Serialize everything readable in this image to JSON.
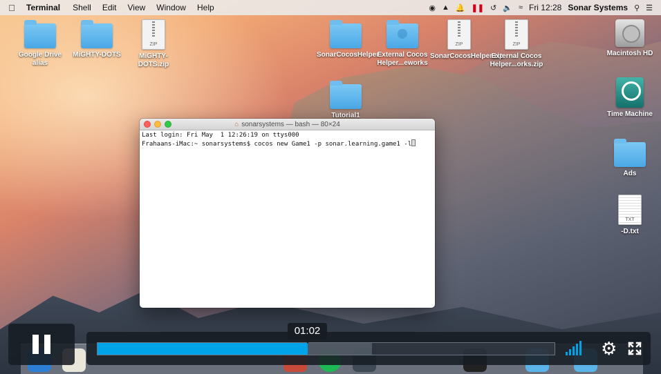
{
  "menubar": {
    "apple_icon": "apple-icon",
    "app_name": "Terminal",
    "menus": [
      "Shell",
      "Edit",
      "View",
      "Window",
      "Help"
    ],
    "clock": "Fri 12:28",
    "username": "Sonar Systems"
  },
  "desktop": {
    "icons": [
      {
        "label": "Google Drive alias",
        "type": "folder"
      },
      {
        "label": "MiGHTY-DOTS",
        "type": "folder"
      },
      {
        "label": "MiGHTY-DOTS.zip",
        "type": "zip"
      },
      {
        "label": "SonarCocosHelper",
        "type": "folder"
      },
      {
        "label": "External Cocos Helper...eworks",
        "type": "folder-user"
      },
      {
        "label": "SonarCocosHelper.zip",
        "type": "zip"
      },
      {
        "label": "External Cocos Helper...orks.zip",
        "type": "zip"
      },
      {
        "label": "Tutorial1",
        "type": "folder"
      },
      {
        "label": "Macintosh HD",
        "type": "hdd"
      },
      {
        "label": "Time Machine",
        "type": "timemachine"
      },
      {
        "label": "Ads",
        "type": "folder"
      },
      {
        "label": "-D.txt",
        "type": "txt"
      }
    ],
    "zip_badge": "ZIP",
    "txt_badge": "TXT"
  },
  "terminal": {
    "title": "sonarsystems — bash — 80×24",
    "lines": [
      "Last login: Fri May  1 12:26:19 on ttys000",
      "Frahaans-iMac:~ sonarsystems$ cocos new Game1 -p sonar.learning.game1 -l"
    ]
  },
  "player": {
    "current_time": "01:02",
    "progress_percent": 46,
    "buffered_percent": 60,
    "volume_level": 5,
    "accent_color": "#00a3e8"
  }
}
